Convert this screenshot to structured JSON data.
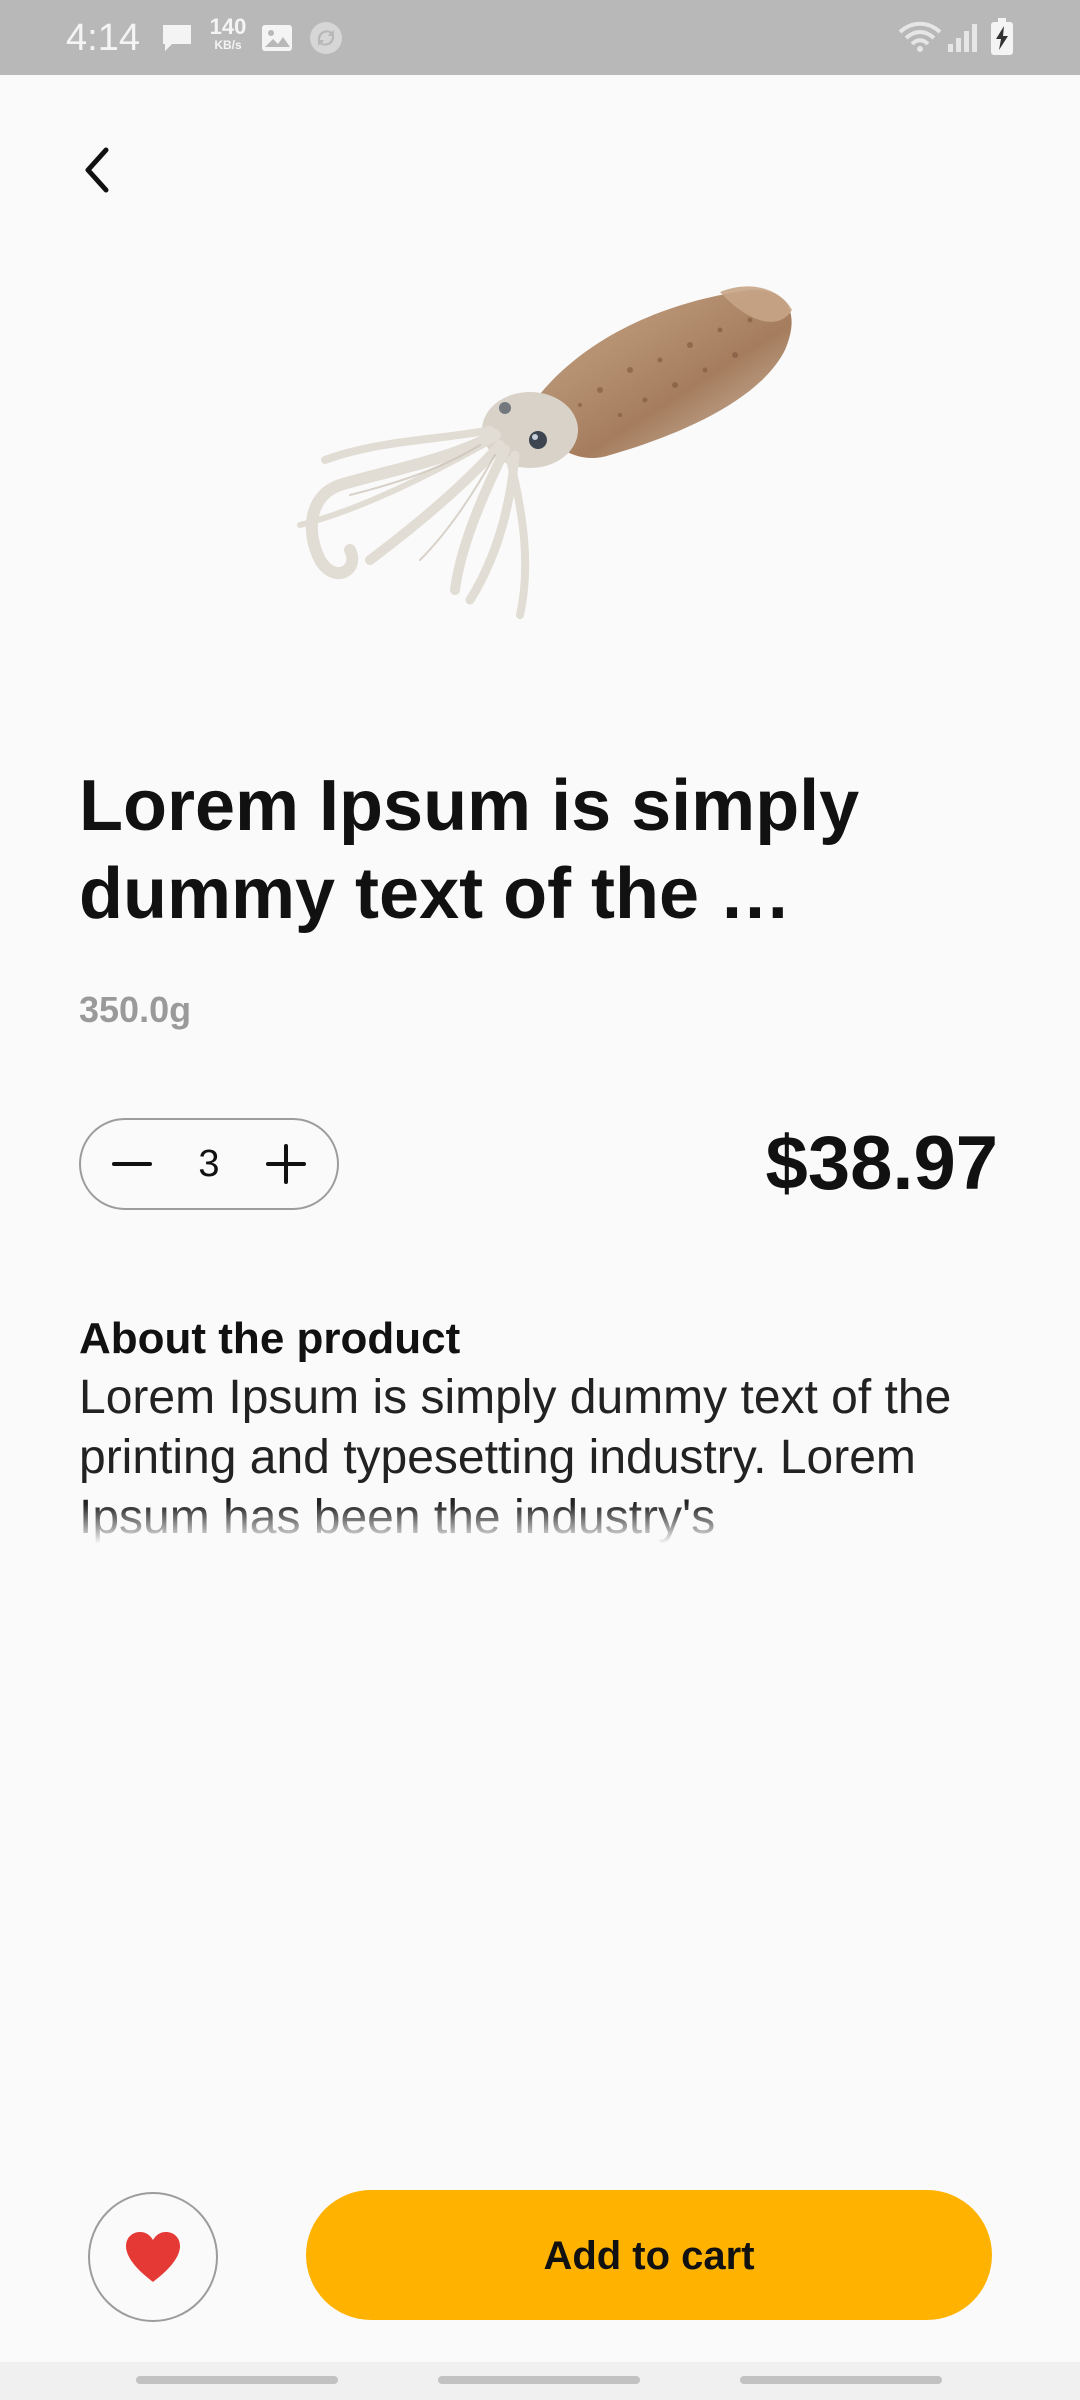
{
  "status_bar": {
    "time": "4:14",
    "speed_value": "140",
    "speed_unit": "KB/s",
    "icons": [
      "message-icon",
      "image-icon",
      "sync-icon",
      "wifi-icon",
      "signal-icon",
      "battery-charging-icon"
    ]
  },
  "product": {
    "title": "Lorem Ipsum is simply dummy text of the …",
    "weight": "350.0g",
    "quantity": "3",
    "price": "$38.97",
    "image": "squid-image"
  },
  "about": {
    "heading": "About the product",
    "text": "Lorem Ipsum is simply dummy text of the printing and typesetting industry. Lorem Ipsum has been the industry's"
  },
  "actions": {
    "favorite": "heart-icon",
    "add_to_cart_label": "Add to cart"
  },
  "colors": {
    "accent": "#ffb300",
    "heart": "#e53935",
    "status_bar": "#b8b8b8",
    "background": "#fafafa"
  }
}
